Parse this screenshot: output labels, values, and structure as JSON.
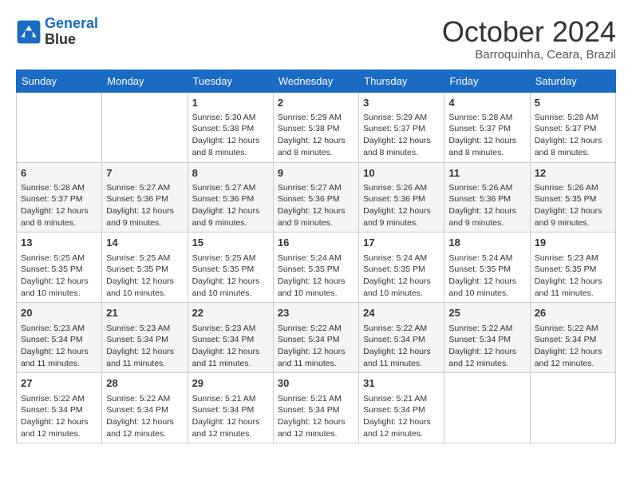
{
  "header": {
    "logo_line1": "General",
    "logo_line2": "Blue",
    "month": "October 2024",
    "location": "Barroquinha, Ceara, Brazil"
  },
  "days_of_week": [
    "Sunday",
    "Monday",
    "Tuesday",
    "Wednesday",
    "Thursday",
    "Friday",
    "Saturday"
  ],
  "weeks": [
    [
      {
        "day": "",
        "info": ""
      },
      {
        "day": "",
        "info": ""
      },
      {
        "day": "1",
        "info": "Sunrise: 5:30 AM\nSunset: 5:38 PM\nDaylight: 12 hours and 8 minutes."
      },
      {
        "day": "2",
        "info": "Sunrise: 5:29 AM\nSunset: 5:38 PM\nDaylight: 12 hours and 8 minutes."
      },
      {
        "day": "3",
        "info": "Sunrise: 5:29 AM\nSunset: 5:37 PM\nDaylight: 12 hours and 8 minutes."
      },
      {
        "day": "4",
        "info": "Sunrise: 5:28 AM\nSunset: 5:37 PM\nDaylight: 12 hours and 8 minutes."
      },
      {
        "day": "5",
        "info": "Sunrise: 5:28 AM\nSunset: 5:37 PM\nDaylight: 12 hours and 8 minutes."
      }
    ],
    [
      {
        "day": "6",
        "info": "Sunrise: 5:28 AM\nSunset: 5:37 PM\nDaylight: 12 hours and 8 minutes."
      },
      {
        "day": "7",
        "info": "Sunrise: 5:27 AM\nSunset: 5:36 PM\nDaylight: 12 hours and 9 minutes."
      },
      {
        "day": "8",
        "info": "Sunrise: 5:27 AM\nSunset: 5:36 PM\nDaylight: 12 hours and 9 minutes."
      },
      {
        "day": "9",
        "info": "Sunrise: 5:27 AM\nSunset: 5:36 PM\nDaylight: 12 hours and 9 minutes."
      },
      {
        "day": "10",
        "info": "Sunrise: 5:26 AM\nSunset: 5:36 PM\nDaylight: 12 hours and 9 minutes."
      },
      {
        "day": "11",
        "info": "Sunrise: 5:26 AM\nSunset: 5:36 PM\nDaylight: 12 hours and 9 minutes."
      },
      {
        "day": "12",
        "info": "Sunrise: 5:26 AM\nSunset: 5:35 PM\nDaylight: 12 hours and 9 minutes."
      }
    ],
    [
      {
        "day": "13",
        "info": "Sunrise: 5:25 AM\nSunset: 5:35 PM\nDaylight: 12 hours and 10 minutes."
      },
      {
        "day": "14",
        "info": "Sunrise: 5:25 AM\nSunset: 5:35 PM\nDaylight: 12 hours and 10 minutes."
      },
      {
        "day": "15",
        "info": "Sunrise: 5:25 AM\nSunset: 5:35 PM\nDaylight: 12 hours and 10 minutes."
      },
      {
        "day": "16",
        "info": "Sunrise: 5:24 AM\nSunset: 5:35 PM\nDaylight: 12 hours and 10 minutes."
      },
      {
        "day": "17",
        "info": "Sunrise: 5:24 AM\nSunset: 5:35 PM\nDaylight: 12 hours and 10 minutes."
      },
      {
        "day": "18",
        "info": "Sunrise: 5:24 AM\nSunset: 5:35 PM\nDaylight: 12 hours and 10 minutes."
      },
      {
        "day": "19",
        "info": "Sunrise: 5:23 AM\nSunset: 5:35 PM\nDaylight: 12 hours and 11 minutes."
      }
    ],
    [
      {
        "day": "20",
        "info": "Sunrise: 5:23 AM\nSunset: 5:34 PM\nDaylight: 12 hours and 11 minutes."
      },
      {
        "day": "21",
        "info": "Sunrise: 5:23 AM\nSunset: 5:34 PM\nDaylight: 12 hours and 11 minutes."
      },
      {
        "day": "22",
        "info": "Sunrise: 5:23 AM\nSunset: 5:34 PM\nDaylight: 12 hours and 11 minutes."
      },
      {
        "day": "23",
        "info": "Sunrise: 5:22 AM\nSunset: 5:34 PM\nDaylight: 12 hours and 11 minutes."
      },
      {
        "day": "24",
        "info": "Sunrise: 5:22 AM\nSunset: 5:34 PM\nDaylight: 12 hours and 11 minutes."
      },
      {
        "day": "25",
        "info": "Sunrise: 5:22 AM\nSunset: 5:34 PM\nDaylight: 12 hours and 12 minutes."
      },
      {
        "day": "26",
        "info": "Sunrise: 5:22 AM\nSunset: 5:34 PM\nDaylight: 12 hours and 12 minutes."
      }
    ],
    [
      {
        "day": "27",
        "info": "Sunrise: 5:22 AM\nSunset: 5:34 PM\nDaylight: 12 hours and 12 minutes."
      },
      {
        "day": "28",
        "info": "Sunrise: 5:22 AM\nSunset: 5:34 PM\nDaylight: 12 hours and 12 minutes."
      },
      {
        "day": "29",
        "info": "Sunrise: 5:21 AM\nSunset: 5:34 PM\nDaylight: 12 hours and 12 minutes."
      },
      {
        "day": "30",
        "info": "Sunrise: 5:21 AM\nSunset: 5:34 PM\nDaylight: 12 hours and 12 minutes."
      },
      {
        "day": "31",
        "info": "Sunrise: 5:21 AM\nSunset: 5:34 PM\nDaylight: 12 hours and 12 minutes."
      },
      {
        "day": "",
        "info": ""
      },
      {
        "day": "",
        "info": ""
      }
    ]
  ]
}
